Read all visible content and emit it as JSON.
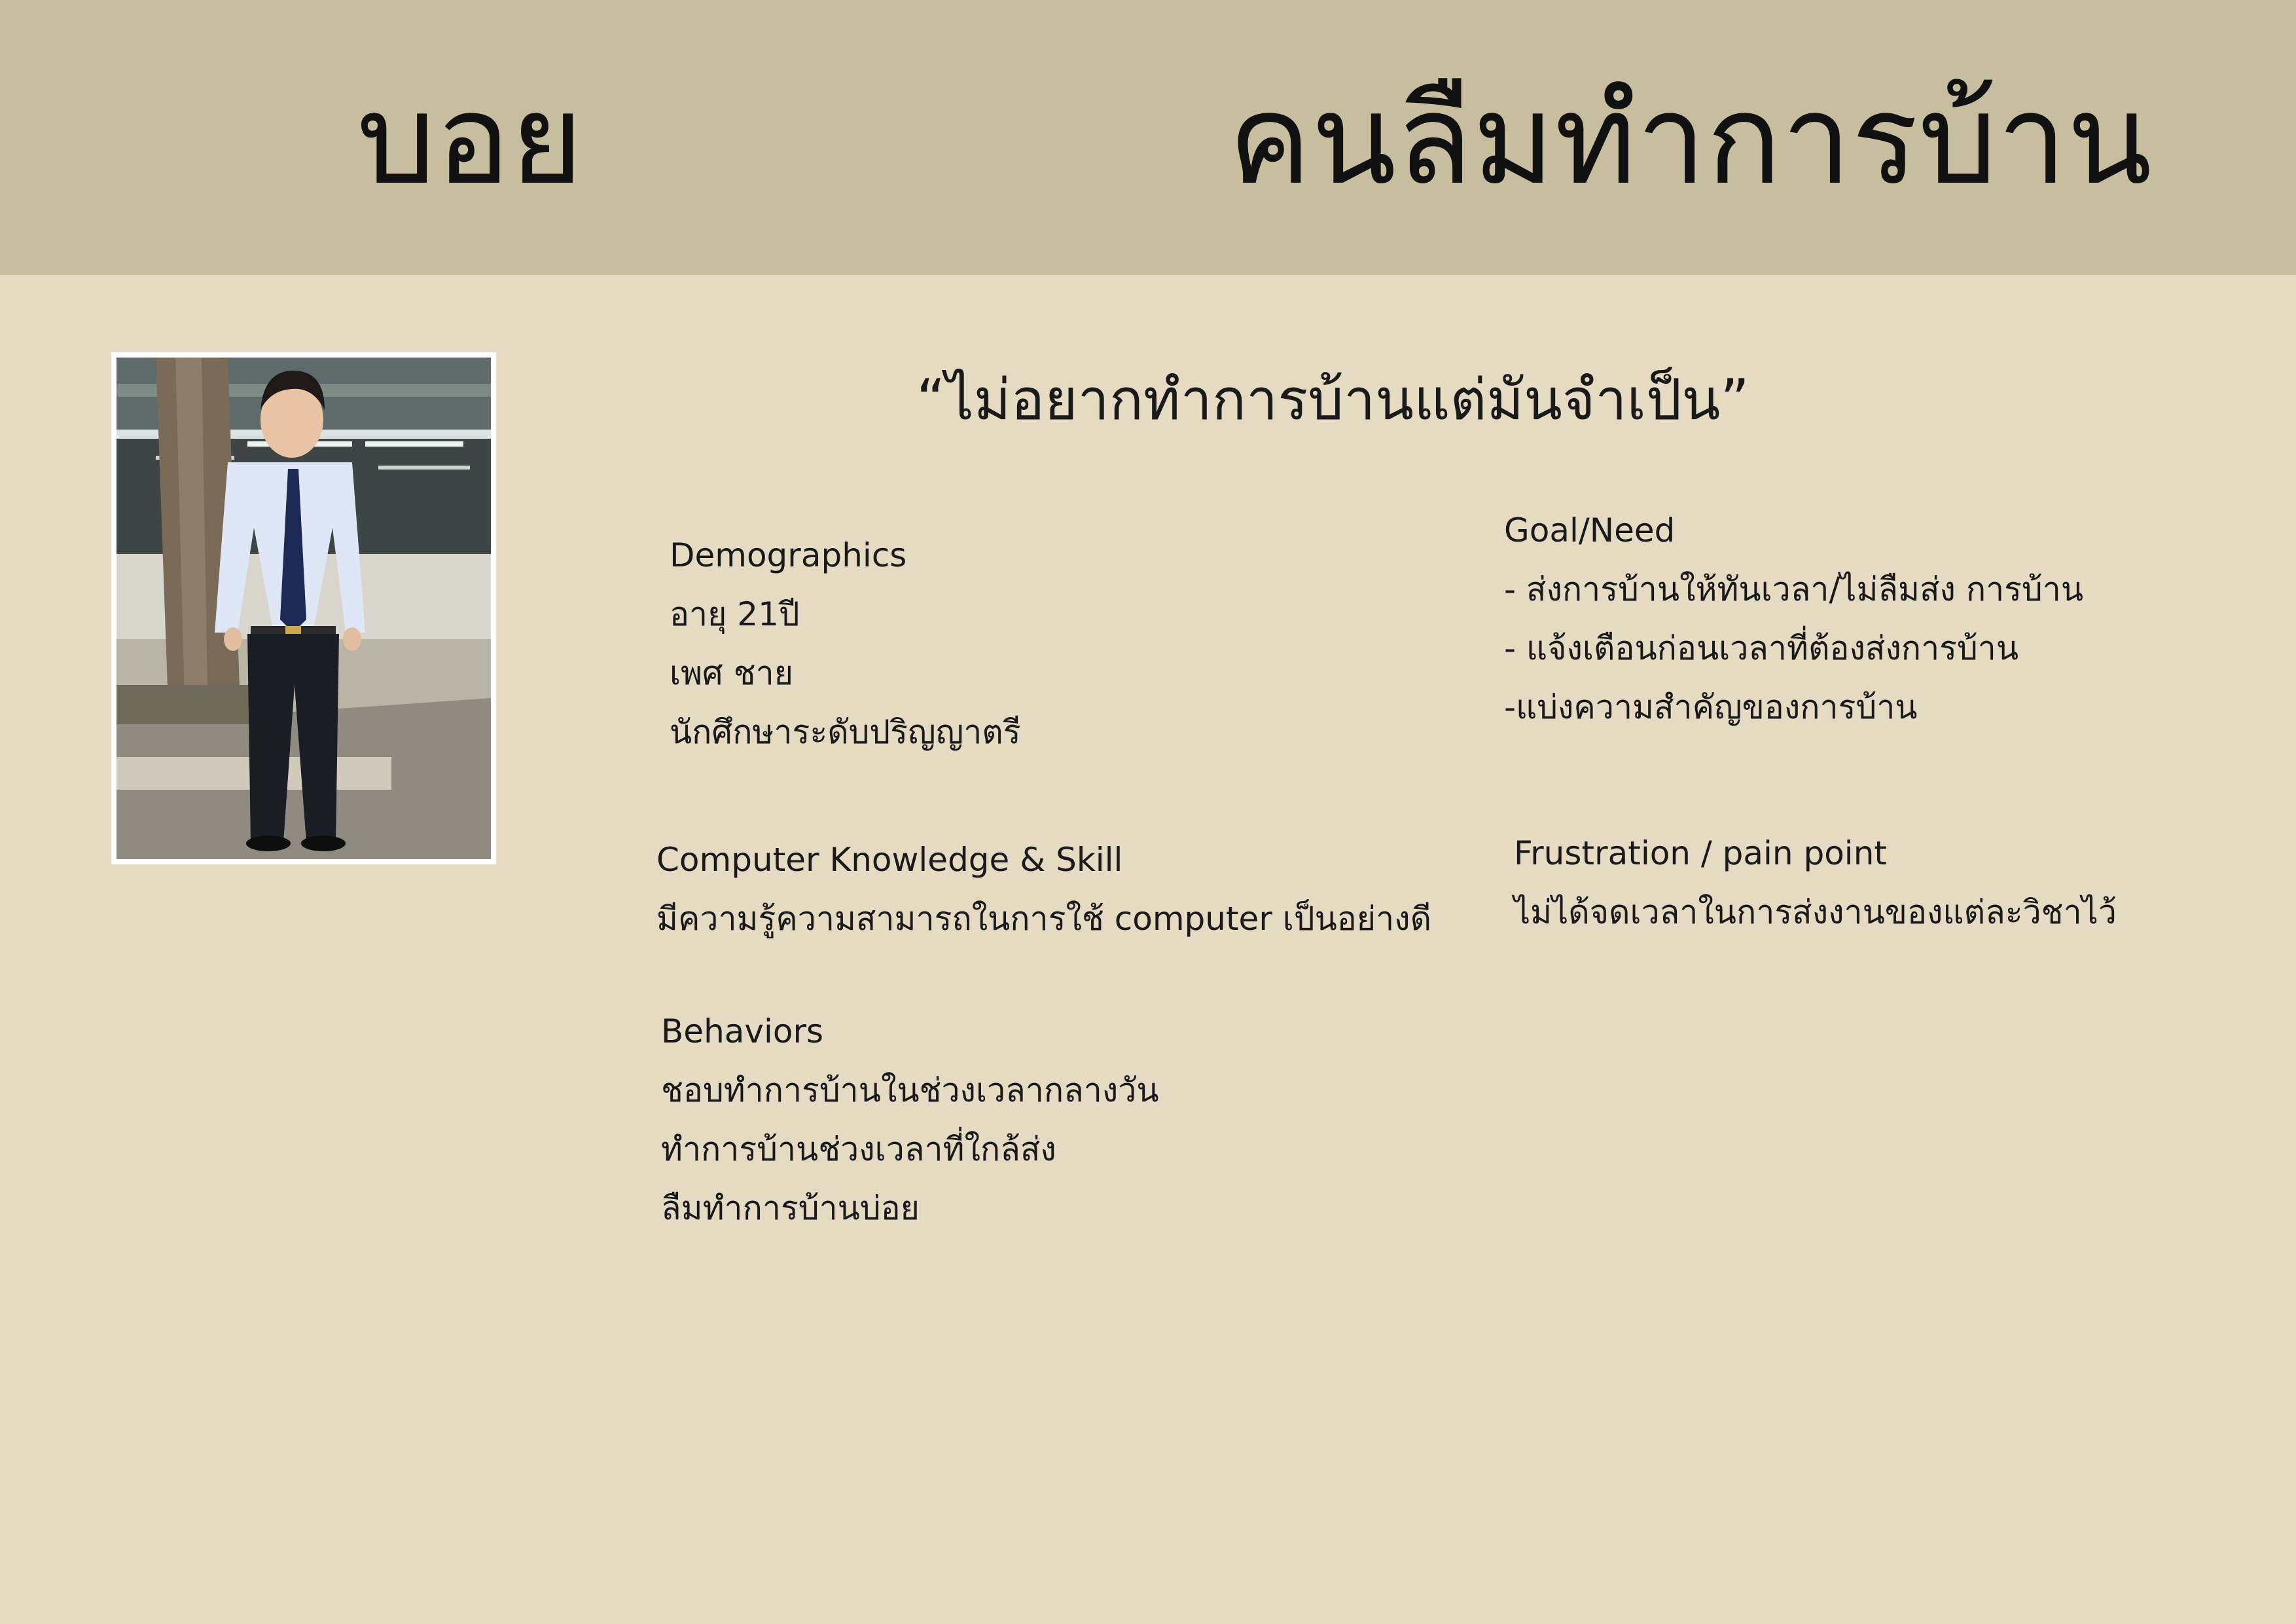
{
  "header": {
    "name": "บอย",
    "role": "คนลืมทำการบ้าน"
  },
  "quote": "“ไม่อยากทำการบ้านแต่มันจำเป็น”",
  "demographics": {
    "title": "Demographics",
    "lines": [
      "อายุ 21ปี",
      "เพศ ชาย",
      "นักศึกษาระดับปริญญาตรี"
    ]
  },
  "computer": {
    "title": "Computer Knowledge & Skill",
    "lines": [
      "มีความรู้ความสามารถในการใช้ computer เป็นอย่างดี"
    ]
  },
  "behaviors": {
    "title": "Behaviors",
    "lines": [
      "ชอบทำการบ้านในช่วงเวลากลางวัน",
      "ทำการบ้านช่วงเวลาที่ใกล้ส่ง",
      "ลืมทำการบ้านบ่อย"
    ]
  },
  "goal": {
    "title": "Goal/Need",
    "lines": [
      "- ส่งการบ้านให้ทันเวลา/ไม่ลืมส่ง การบ้าน",
      "- แจ้งเตือนก่อนเวลาที่ต้องส่งการบ้าน",
      "-แบ่งความสำคัญของการบ้าน"
    ]
  },
  "frustration": {
    "title": "Frustration / pain point",
    "lines": [
      "ไม่ได้จดเวลาในการส่งงานของแต่ละวิชาไว้"
    ]
  },
  "colors": {
    "header_bg": "#c7bea0",
    "page_bg": "#e5dbc3",
    "text": "#1a1a1a"
  }
}
